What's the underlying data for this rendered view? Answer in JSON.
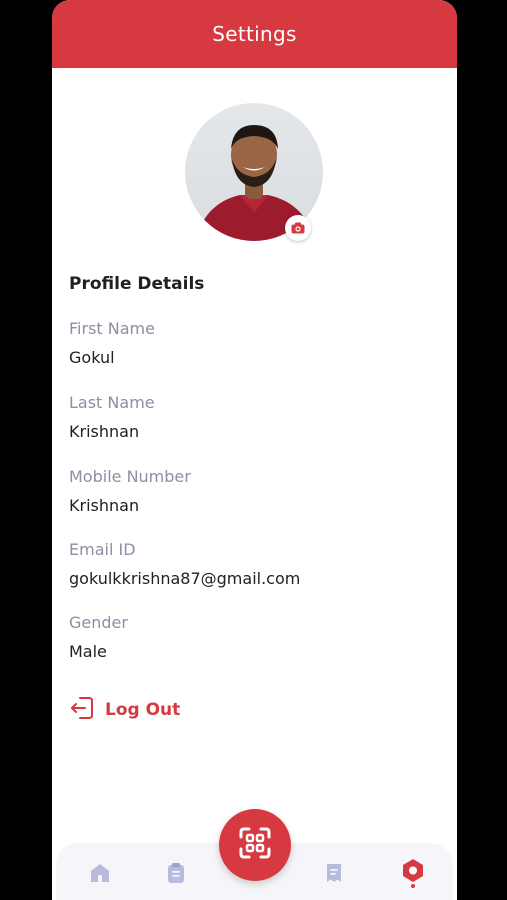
{
  "header": {
    "title": "Settings"
  },
  "profile": {
    "section_title": "Profile Details",
    "fields": [
      {
        "label": "First Name",
        "value": "Gokul"
      },
      {
        "label": "Last Name",
        "value": "Krishnan"
      },
      {
        "label": "Mobile Number",
        "value": "Krishnan"
      },
      {
        "label": "Email ID",
        "value": "gokulkkrishna87@gmail.com"
      },
      {
        "label": "Gender",
        "value": "Male"
      }
    ]
  },
  "actions": {
    "logout_label": "Log Out"
  },
  "nav": {
    "items": [
      {
        "icon": "home-icon",
        "active": false
      },
      {
        "icon": "clipboard-icon",
        "active": false
      },
      {
        "icon": "scan-icon",
        "active": false
      },
      {
        "icon": "receipt-icon",
        "active": false
      },
      {
        "icon": "settings-icon",
        "active": true
      }
    ]
  },
  "colors": {
    "accent": "#d63a40",
    "inactive_icon": "#b9bbdc",
    "label": "#8e8ea4",
    "text": "#1f1f24"
  }
}
